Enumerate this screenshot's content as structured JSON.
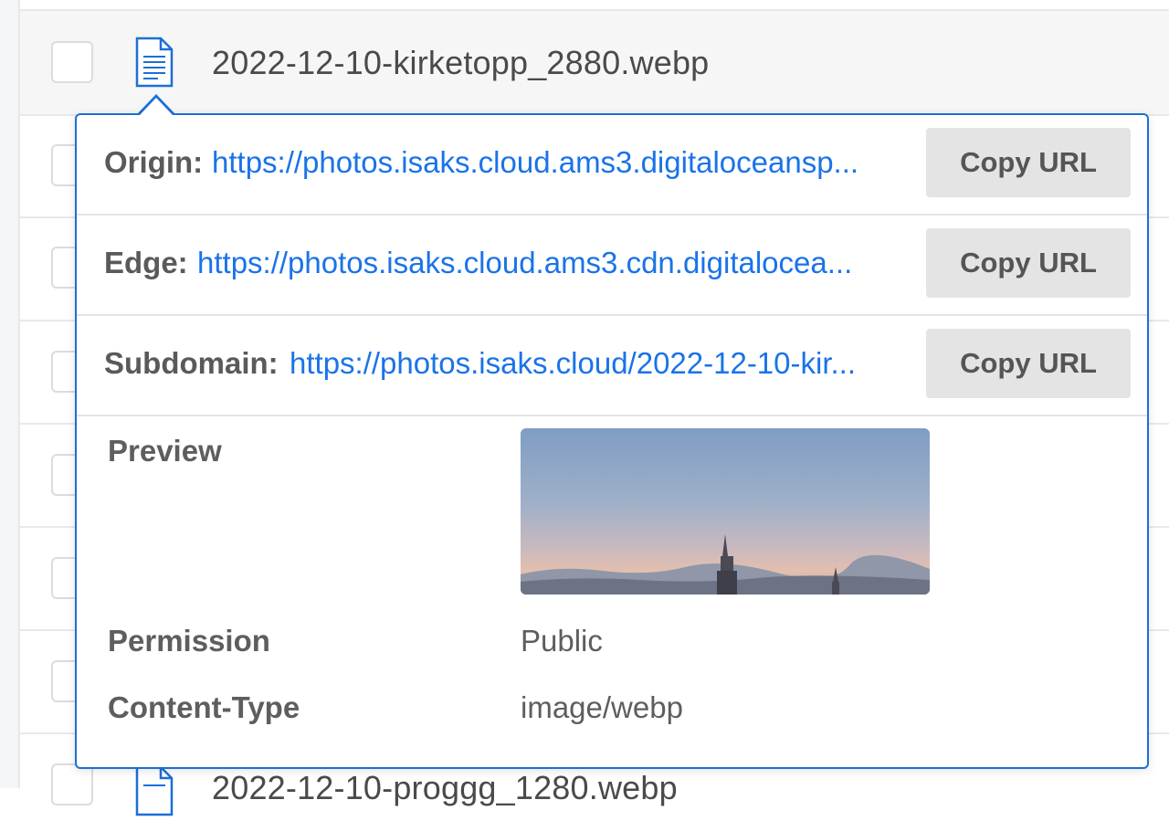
{
  "file_list": {
    "selected_row": {
      "filename": "2022-12-10-kirketopp_2880.webp",
      "icon": "document-icon"
    },
    "partial_row": {
      "filename": "2022-12-10-proggg_1280.webp",
      "icon": "document-icon"
    }
  },
  "popover": {
    "urls": [
      {
        "label": "Origin:",
        "url": "https://photos.isaks.cloud.ams3.digitaloceansp...",
        "button": "Copy URL"
      },
      {
        "label": "Edge:",
        "url": "https://photos.isaks.cloud.ams3.cdn.digitalocea...",
        "button": "Copy URL"
      },
      {
        "label": "Subdomain:",
        "url": "https://photos.isaks.cloud/2022-12-10-kir...",
        "button": "Copy URL"
      }
    ],
    "preview_label": "Preview",
    "permission_label": "Permission",
    "permission_value": "Public",
    "content_type_label": "Content-Type",
    "content_type_value": "image/webp"
  },
  "colors": {
    "accent": "#1c6fd6",
    "link": "#1a73e8",
    "button_bg": "#e4e4e4"
  }
}
